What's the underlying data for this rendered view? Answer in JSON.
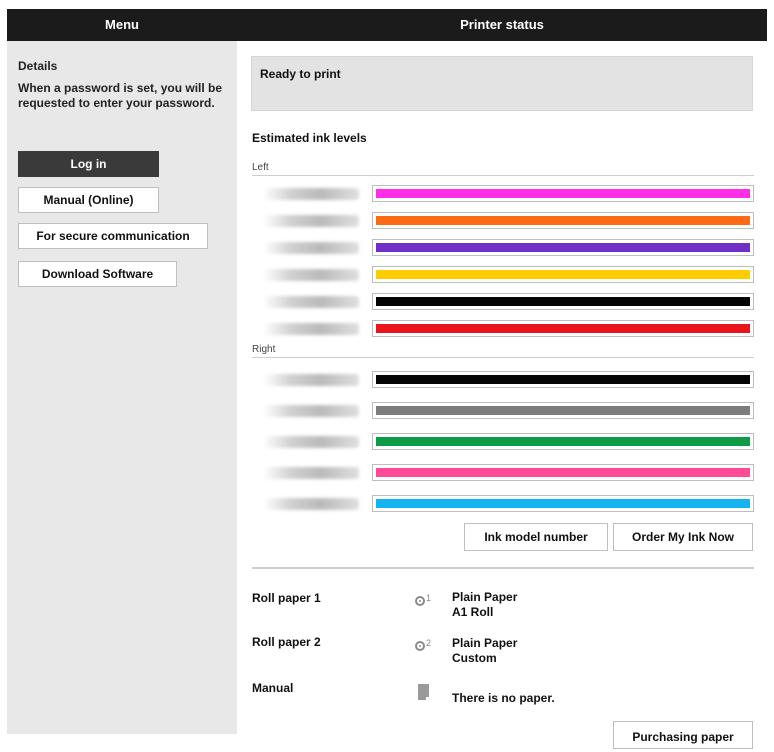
{
  "header": {
    "menu_title": "Menu",
    "status_title": "Printer status"
  },
  "sidebar": {
    "details": "Details",
    "password_note": "When a password is set, you will be requested to enter your password.",
    "buttons": {
      "login": "Log in",
      "manual": "Manual (Online)",
      "secure": "For secure communication",
      "download": "Download Software"
    }
  },
  "main": {
    "status": "Ready to print",
    "ink_title": "Estimated ink levels",
    "groups": {
      "left": "Left",
      "right": "Right"
    },
    "inks_left": [
      {
        "name": "",
        "color": "#ff2ee6",
        "level": 1.0
      },
      {
        "name": "",
        "color": "#ff6a14",
        "level": 1.0
      },
      {
        "name": "",
        "color": "#7030c8",
        "level": 1.0
      },
      {
        "name": "",
        "color": "#ffcc00",
        "level": 1.0
      },
      {
        "name": "",
        "color": "#050505",
        "level": 1.0
      },
      {
        "name": "",
        "color": "#e8161c",
        "level": 1.0
      }
    ],
    "inks_right": [
      {
        "name": "",
        "color": "#050505",
        "level": 1.0
      },
      {
        "name": "",
        "color": "#7d7d7d",
        "level": 1.0
      },
      {
        "name": "",
        "color": "#0f9a48",
        "level": 1.0
      },
      {
        "name": "",
        "color": "#ff4a96",
        "level": 1.0
      },
      {
        "name": "",
        "color": "#14b4f0",
        "level": 1.0
      }
    ],
    "buttons": {
      "ink_model": "Ink model number",
      "order_ink": "Order My Ink Now"
    },
    "paper": {
      "roll1": {
        "label": "Roll paper 1",
        "icon": "roll-paper-icon",
        "type": "Plain Paper",
        "size": "A1 Roll"
      },
      "roll2": {
        "label": "Roll paper 2",
        "icon": "roll-paper-icon",
        "type": "Plain Paper",
        "size": "Custom"
      },
      "manual": {
        "label": "Manual",
        "icon": "sheet-paper-icon",
        "value": "There is no paper."
      }
    },
    "purchase": "Purchasing paper"
  }
}
